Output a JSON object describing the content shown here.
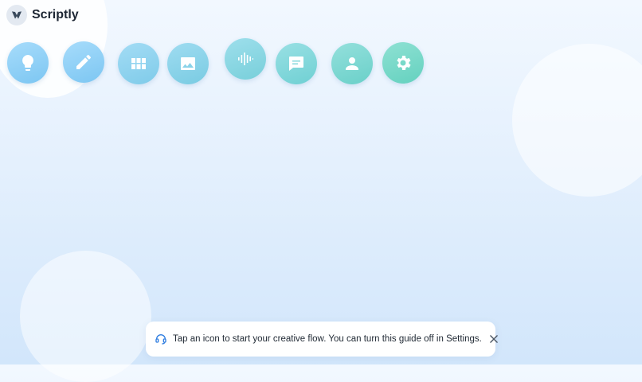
{
  "app": {
    "name": "Scriptly"
  },
  "icons": [
    {
      "name": "lightbulb-icon",
      "color_a": "#a7dcfb",
      "color_b": "#7cc6f2"
    },
    {
      "name": "pencil-icon",
      "color_a": "#a7dcfb",
      "color_b": "#7cc6f2"
    },
    {
      "name": "grid-icon",
      "color_a": "#a3dcf5",
      "color_b": "#7fcbe9"
    },
    {
      "name": "image-icon",
      "color_a": "#9fdcf1",
      "color_b": "#79cbe2"
    },
    {
      "name": "audio-waveform-icon",
      "color_a": "#9edfec",
      "color_b": "#78cfda"
    },
    {
      "name": "chat-bubble-icon",
      "color_a": "#99e0e4",
      "color_b": "#6fd0d3"
    },
    {
      "name": "user-icon",
      "color_a": "#94e0dc",
      "color_b": "#6ad0c9"
    },
    {
      "name": "gear-icon",
      "color_a": "#8fe1d3",
      "color_b": "#64d1bf"
    }
  ],
  "toast": {
    "message": "Tap an icon to start your creative flow. You can turn this guide off in Settings.",
    "icon": "support-headset-icon",
    "accent": "#2f7de0"
  }
}
